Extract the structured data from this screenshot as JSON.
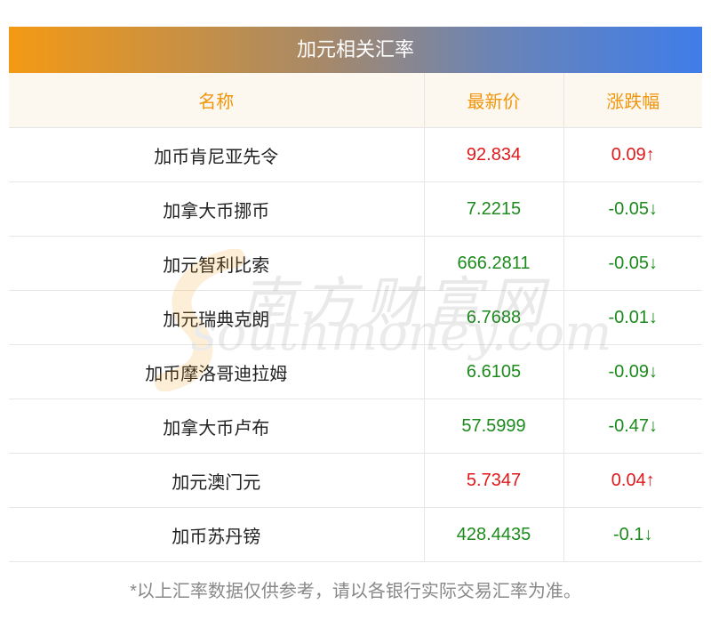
{
  "title": "加元相关汇率",
  "columns": [
    "名称",
    "最新价",
    "涨跌幅"
  ],
  "rows": [
    {
      "name": "加币肯尼亚先令",
      "price": "92.834",
      "change": "0.09↑",
      "direction": "up"
    },
    {
      "name": "加拿大币挪币",
      "price": "7.2215",
      "change": "-0.05↓",
      "direction": "down"
    },
    {
      "name": "加元智利比索",
      "price": "666.2811",
      "change": "-0.05↓",
      "direction": "down"
    },
    {
      "name": "加元瑞典克朗",
      "price": "6.7688",
      "change": "-0.01↓",
      "direction": "down"
    },
    {
      "name": "加币摩洛哥迪拉姆",
      "price": "6.6105",
      "change": "-0.09↓",
      "direction": "down"
    },
    {
      "name": "加拿大币卢布",
      "price": "57.5999",
      "change": "-0.47↓",
      "direction": "down"
    },
    {
      "name": "加元澳门元",
      "price": "5.7347",
      "change": "0.04↑",
      "direction": "up"
    },
    {
      "name": "加币苏丹镑",
      "price": "428.4435",
      "change": "-0.1↓",
      "direction": "down"
    }
  ],
  "watermark": {
    "cn": "南方财富网",
    "en": "southmoney.com"
  },
  "footnote": "*以上汇率数据仅供参考，请以各银行实际交易汇率为准。",
  "colors": {
    "up": "#e0191b",
    "down": "#1c8a1c",
    "header": "#f0950d",
    "gradient_start": "#f39a14",
    "gradient_end": "#3f7de9"
  }
}
